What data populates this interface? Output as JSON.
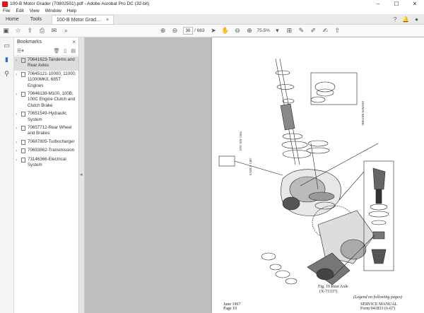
{
  "window": {
    "title": "100-B Motor Grader (70802501).pdf - Adobe Acrobat Pro DC (32-bit)",
    "controls": [
      "–",
      "☐",
      "✕"
    ]
  },
  "menu": [
    "File",
    "Edit",
    "View",
    "Window",
    "Help"
  ],
  "tabs": {
    "home": "Home",
    "tools": "Tools",
    "document": "100-B Motor Grad...",
    "close": "×"
  },
  "toolbar": {
    "page_current": "30",
    "page_total": "/ 663",
    "zoom": "75.5%"
  },
  "bookmarks": {
    "title": "Bookmarks",
    "items": [
      {
        "label": "70641623-Tandems and Rear Axles",
        "selected": true
      },
      {
        "label": "70645121-10000, 11000, 11000MKII, 685T Engines",
        "selected": false
      },
      {
        "label": "70646138-M100, 100B, 100C Engine Clutch and Clutch Brake",
        "selected": false
      },
      {
        "label": "70651549-Hydraulic System",
        "selected": false
      },
      {
        "label": "70657712-Rear Wheel and Brakes",
        "selected": false
      },
      {
        "label": "70687805-Turbocharger",
        "selected": false
      },
      {
        "label": "70693862-Transmission",
        "selected": false
      },
      {
        "label": "73146366-Electrical System",
        "selected": false
      }
    ]
  },
  "document": {
    "fig_caption": "Fig. 10  Rear Axle",
    "fig_ref": "(X-71337)",
    "legend_note": "(Legend on following pages)",
    "footer_left_1": "June 1967",
    "footer_left_2": "Page 10",
    "footer_right_1": "SERVICE MANUAL",
    "footer_right_2": "Form 041833 (6-67)"
  },
  "icons": {
    "save": "save-icon",
    "star": "star-icon",
    "upload": "upload-icon",
    "print": "print-icon",
    "mail": "mail-icon",
    "search": "search-icon",
    "prev": "arrow-up-icon",
    "next": "arrow-down-icon",
    "select": "cursor-icon",
    "hand": "hand-icon",
    "zoom_out": "zoom-out-icon",
    "zoom_in": "zoom-in-icon"
  }
}
